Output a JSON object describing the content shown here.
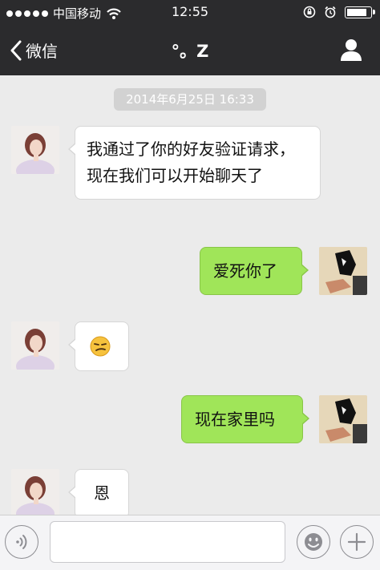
{
  "status_bar": {
    "carrier": "中国移动",
    "time": "12:55",
    "battery_level": 0.9
  },
  "nav": {
    "back_label": "微信",
    "title": "°。Z"
  },
  "chat": {
    "timestamp": "2014年6月25日 16:33",
    "messages": [
      {
        "side": "in",
        "text": "我通过了你的好友验证请求，现在我们可以开始聊天了"
      },
      {
        "side": "out",
        "text": "爱死你了"
      },
      {
        "side": "in",
        "text": "",
        "emoji": "smirk-emoji"
      },
      {
        "side": "out",
        "text": "现在家里吗"
      },
      {
        "side": "in",
        "text": "恩"
      }
    ]
  },
  "input_bar": {
    "placeholder": ""
  },
  "icons": [
    "signal-dots-icon",
    "wifi-icon",
    "rotation-lock-icon",
    "alarm-icon",
    "battery-icon",
    "back-chevron-icon",
    "profile-icon",
    "voice-icon",
    "emoji-icon",
    "plus-icon"
  ],
  "colors": {
    "nav_background": "#2b2b2d",
    "chat_background": "#ebebeb",
    "outgoing_bubble": "#a0e559",
    "incoming_bubble": "#ffffff",
    "timestamp_pill": "#d2d2d2"
  }
}
